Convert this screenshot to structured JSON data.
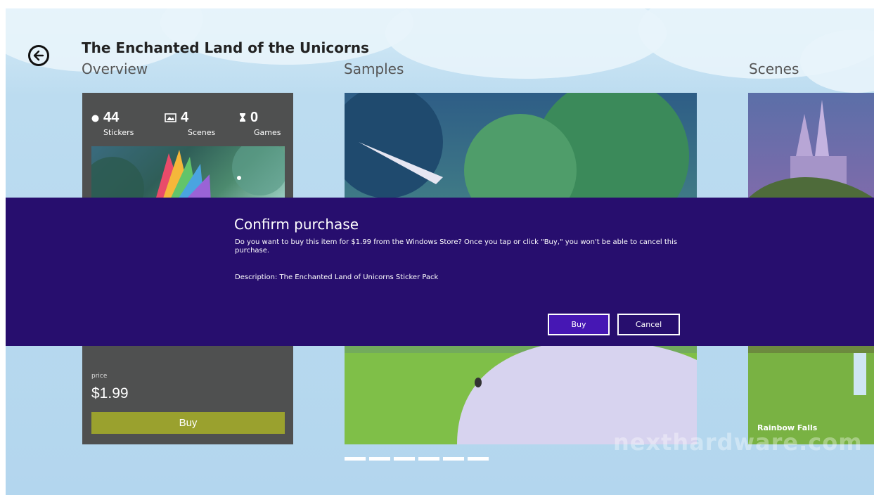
{
  "header": {
    "app_title": "The Enchanted Land of the Unicorns"
  },
  "sections": {
    "overview": "Overview",
    "samples": "Samples",
    "scenes": "Scenes"
  },
  "overview": {
    "stats": [
      {
        "value": "44",
        "label": "Stickers",
        "icon": "sticker-icon"
      },
      {
        "value": "4",
        "label": "Scenes",
        "icon": "scene-icon"
      },
      {
        "value": "0",
        "label": "Games",
        "icon": "game-icon"
      }
    ],
    "price_label": "price",
    "price_value": "$1.99",
    "buy_label": "Buy"
  },
  "samples": {
    "page_count": 6
  },
  "scenes": {
    "caption": "Rainbow Falls"
  },
  "dialog": {
    "title": "Confirm purchase",
    "body": "Do you want to buy this item for $1.99 from the Windows Store? Once you tap or click \"Buy,\" you won't be able to cancel this purchase.",
    "description": "Description: The Enchanted Land of Unicorns Sticker Pack",
    "buy_label": "Buy",
    "cancel_label": "Cancel"
  },
  "watermark": "nexthardware.com",
  "colors": {
    "dialog_bg": "#270e6e",
    "dialog_primary_button": "#4617b4",
    "panel_buy_button": "#9aa12e",
    "panel_bg": "#4f5050"
  }
}
